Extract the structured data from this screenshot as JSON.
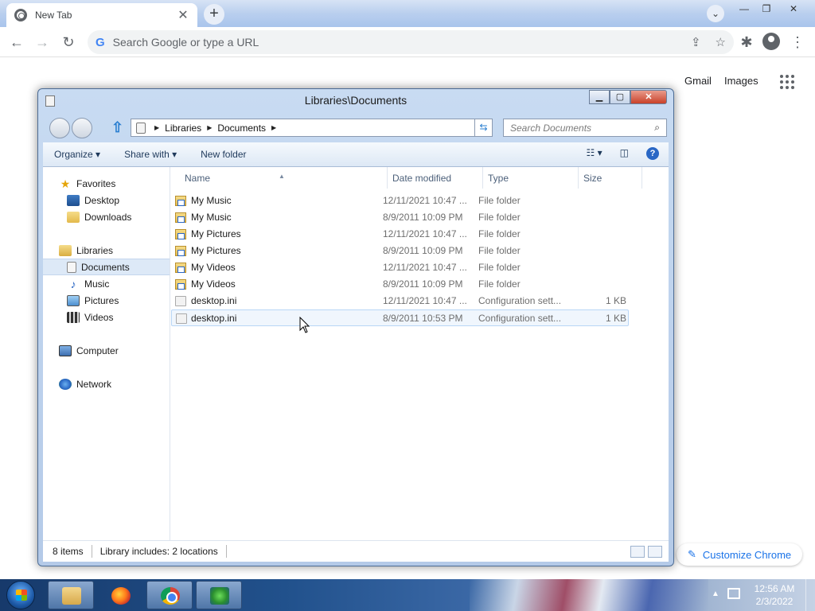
{
  "chrome": {
    "tab_title": "New Tab",
    "tab_close": "✕",
    "new_tab": "+",
    "tab_search": "⌄",
    "window_minimize": "—",
    "window_restore": "❐",
    "window_close": "✕",
    "back": "←",
    "forward": "→",
    "reload": "↻",
    "omnibox_placeholder": "Search Google or type a URL",
    "share": "⇪",
    "bookmark": "☆",
    "extensions": "✱",
    "menu": "⋮",
    "gmail": "Gmail",
    "images": "Images",
    "customize": "Customize Chrome",
    "customize_icon": "✎"
  },
  "explorer": {
    "title": "Libraries\\Documents",
    "minimize": "▁",
    "maximize": "▢",
    "close": "✕",
    "breadcrumb": [
      "Libraries",
      "Documents"
    ],
    "search_placeholder": "Search Documents",
    "search_icon": "⌕",
    "refresh_icon": "⇆",
    "commands": {
      "organize": "Organize ▾",
      "share_with": "Share with ▾",
      "new_folder": "New folder",
      "views": "☷ ▾",
      "preview": "◫",
      "help": "?"
    },
    "nav": {
      "favorites": "Favorites",
      "desktop": "Desktop",
      "downloads": "Downloads",
      "libraries": "Libraries",
      "documents": "Documents",
      "music": "Music",
      "pictures": "Pictures",
      "videos": "Videos",
      "computer": "Computer",
      "network": "Network"
    },
    "columns": {
      "name": "Name",
      "date": "Date modified",
      "type": "Type",
      "size": "Size"
    },
    "files": [
      {
        "name": "My Music",
        "date": "12/11/2021 10:47 ...",
        "type": "File folder",
        "size": ""
      },
      {
        "name": "My Music",
        "date": "8/9/2011 10:09 PM",
        "type": "File folder",
        "size": ""
      },
      {
        "name": "My Pictures",
        "date": "12/11/2021 10:47 ...",
        "type": "File folder",
        "size": ""
      },
      {
        "name": "My Pictures",
        "date": "8/9/2011 10:09 PM",
        "type": "File folder",
        "size": ""
      },
      {
        "name": "My Videos",
        "date": "12/11/2021 10:47 ...",
        "type": "File folder",
        "size": ""
      },
      {
        "name": "My Videos",
        "date": "8/9/2011 10:09 PM",
        "type": "File folder",
        "size": ""
      },
      {
        "name": "desktop.ini",
        "date": "12/11/2021 10:47 ...",
        "type": "Configuration sett...",
        "size": "1 KB"
      },
      {
        "name": "desktop.ini",
        "date": "8/9/2011 10:53 PM",
        "type": "Configuration sett...",
        "size": "1 KB"
      }
    ],
    "status": {
      "count": "8 items",
      "library": "Library includes: 2 locations"
    }
  },
  "taskbar": {
    "time": "12:56 AM",
    "date": "2/3/2022",
    "tray_up": "▲"
  }
}
